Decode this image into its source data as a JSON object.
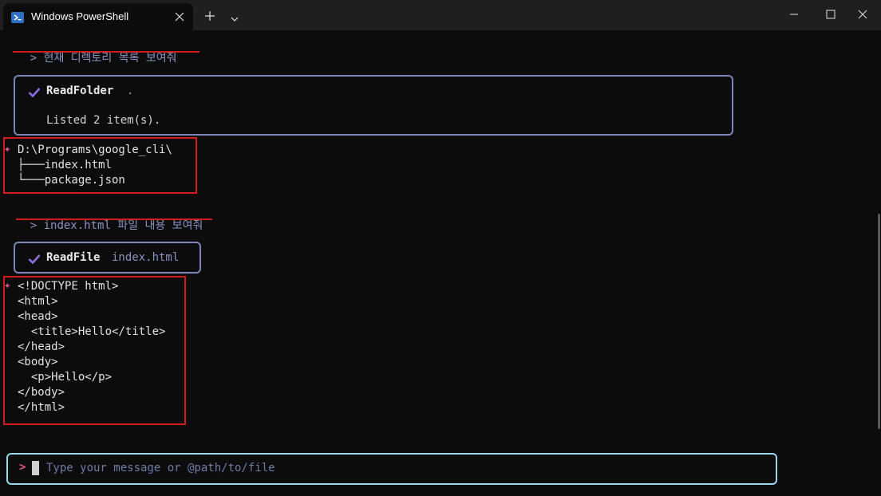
{
  "window": {
    "tab_title": "Windows PowerShell",
    "icons": {
      "app": "powershell-icon",
      "close_tab": "close-icon",
      "new_tab": "plus-icon",
      "menu": "chevron-down-icon",
      "minimize": "minimize-icon",
      "maximize": "maximize-icon",
      "close": "close-icon"
    }
  },
  "session": {
    "prompt_symbol": ">",
    "query1": "현재 디렉토리 목록 보여줘",
    "tool1": {
      "name": "ReadFolder",
      "arg": ".",
      "result": "Listed 2 item(s)."
    },
    "response1": {
      "marker": "✦",
      "lines": [
        "D:\\Programs\\google_cli\\",
        "├───index.html",
        "└───package.json"
      ]
    },
    "query2": "index.html 파일 내용 보여줘",
    "tool2": {
      "name": "ReadFile",
      "arg": "index.html"
    },
    "response2": {
      "marker": "✦",
      "lines": [
        "<!DOCTYPE html>",
        "<html>",
        "<head>",
        "  <title>Hello</title>",
        "</head>",
        "<body>",
        "  <p>Hello</p>",
        "</body>",
        "</html>"
      ]
    }
  },
  "input": {
    "prompt": ">",
    "placeholder": "Type your message or @path/to/file"
  },
  "colors": {
    "accent_red": "#d01c1c",
    "tool_border": "#7a86b5",
    "input_border": "#9ad8ec",
    "marker": "#e0588e"
  }
}
